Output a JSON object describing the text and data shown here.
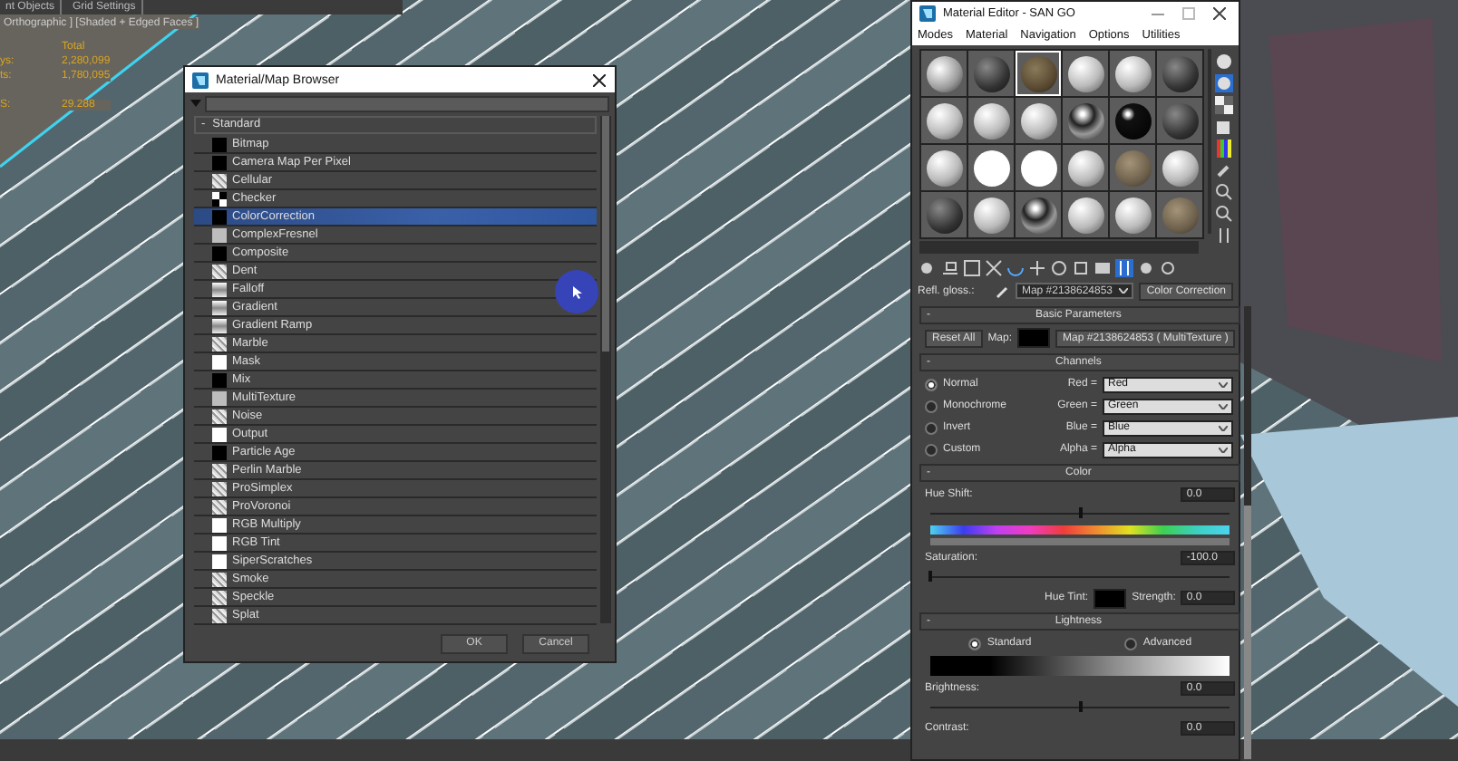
{
  "viewport": {
    "tabs": [
      "nt Objects",
      "Grid Settings"
    ],
    "label": "Orthographic ] [Shaded + Edged Faces ]",
    "stats": {
      "heading": "Total",
      "rows": [
        {
          "kind": "count",
          "label": "ys:",
          "value": "2,280,099"
        },
        {
          "kind": "count",
          "label": "ts:",
          "value": "1,780,095"
        },
        {
          "kind": "fps",
          "label": "S:",
          "value": "29.288"
        }
      ]
    }
  },
  "map_browser": {
    "title": "Material/Map Browser",
    "group": {
      "toggle": "-",
      "label": "Standard"
    },
    "items": [
      {
        "label": "Bitmap",
        "kind": "black",
        "selected": false
      },
      {
        "label": "Camera Map Per Pixel",
        "kind": "black",
        "selected": false
      },
      {
        "label": "Cellular",
        "kind": "noise",
        "selected": false
      },
      {
        "label": "Checker",
        "kind": "checker",
        "selected": false
      },
      {
        "label": "ColorCorrection",
        "kind": "black",
        "selected": true
      },
      {
        "label": "ComplexFresnel",
        "kind": "grey",
        "selected": false
      },
      {
        "label": "Composite",
        "kind": "black",
        "selected": false
      },
      {
        "label": "Dent",
        "kind": "noise",
        "selected": false
      },
      {
        "label": "Falloff",
        "kind": "gradient",
        "selected": false
      },
      {
        "label": "Gradient",
        "kind": "gradient",
        "selected": false
      },
      {
        "label": "Gradient Ramp",
        "kind": "gradient",
        "selected": false
      },
      {
        "label": "Marble",
        "kind": "noise",
        "selected": false
      },
      {
        "label": "Mask",
        "kind": "white",
        "selected": false
      },
      {
        "label": "Mix",
        "kind": "black",
        "selected": false
      },
      {
        "label": "MultiTexture",
        "kind": "grey",
        "selected": false
      },
      {
        "label": "Noise",
        "kind": "noise",
        "selected": false
      },
      {
        "label": "Output",
        "kind": "white",
        "selected": false
      },
      {
        "label": "Particle Age",
        "kind": "black",
        "selected": false
      },
      {
        "label": "Perlin Marble",
        "kind": "noise",
        "selected": false
      },
      {
        "label": "ProSimplex",
        "kind": "noise",
        "selected": false
      },
      {
        "label": "ProVoronoi",
        "kind": "noise",
        "selected": false
      },
      {
        "label": "RGB Multiply",
        "kind": "white",
        "selected": false
      },
      {
        "label": "RGB Tint",
        "kind": "white",
        "selected": false
      },
      {
        "label": "SiperScratches",
        "kind": "white",
        "selected": false
      },
      {
        "label": "Smoke",
        "kind": "noise",
        "selected": false
      },
      {
        "label": "Speckle",
        "kind": "noise",
        "selected": false
      },
      {
        "label": "Splat",
        "kind": "noise",
        "selected": false
      }
    ],
    "buttons": [
      "OK",
      "Cancel"
    ]
  },
  "material_editor": {
    "title": "Material Editor - SAN GO",
    "menu": [
      "Modes",
      "Material",
      "Navigation",
      "Options",
      "Utilities"
    ],
    "slots": [
      {
        "kind": "pattern",
        "selected": false
      },
      {
        "kind": "dark",
        "selected": false
      },
      {
        "kind": "wood",
        "selected": true
      },
      {
        "kind": "light",
        "selected": false
      },
      {
        "kind": "light",
        "selected": false
      },
      {
        "kind": "dark",
        "selected": false
      },
      {
        "kind": "light",
        "selected": false
      },
      {
        "kind": "light",
        "selected": false
      },
      {
        "kind": "light",
        "selected": false
      },
      {
        "kind": "chrome",
        "selected": false
      },
      {
        "kind": "black",
        "selected": false
      },
      {
        "kind": "dark",
        "selected": false
      },
      {
        "kind": "light",
        "selected": false
      },
      {
        "kind": "flat",
        "selected": false
      },
      {
        "kind": "flat",
        "selected": false
      },
      {
        "kind": "light",
        "selected": false
      },
      {
        "kind": "stone",
        "selected": false
      },
      {
        "kind": "light",
        "selected": false
      },
      {
        "kind": "dark",
        "selected": false
      },
      {
        "kind": "light",
        "selected": false
      },
      {
        "kind": "chrome",
        "selected": false
      },
      {
        "kind": "light",
        "selected": false
      },
      {
        "kind": "light",
        "selected": false
      },
      {
        "kind": "stone",
        "selected": false
      }
    ],
    "map_row": {
      "label": "Refl. gloss.:",
      "map": "Map #2138624853",
      "type_button": "Color Correction"
    },
    "basic_parameters": {
      "toggle": "-",
      "title": "Basic Parameters",
      "reset": "Reset All",
      "map_label": "Map:",
      "map_button": "Map #2138624853 ( MultiTexture )"
    },
    "channels": {
      "toggle": "-",
      "title": "Channels",
      "modes": [
        {
          "label": "Normal",
          "selected": true
        },
        {
          "label": "Monochrome",
          "selected": false
        },
        {
          "label": "Invert",
          "selected": false
        },
        {
          "label": "Custom",
          "selected": false
        }
      ],
      "mappings": [
        {
          "label": "Red =",
          "value": "Red"
        },
        {
          "label": "Green =",
          "value": "Green"
        },
        {
          "label": "Blue =",
          "value": "Blue"
        },
        {
          "label": "Alpha =",
          "value": "Alpha"
        }
      ]
    },
    "color": {
      "toggle": "-",
      "title": "Color",
      "hue_shift": {
        "label": "Hue Shift:",
        "value": "0.0",
        "level": 0.5
      },
      "saturation": {
        "label": "Saturation:",
        "value": "-100.0",
        "level": 0.0
      },
      "hue_tint": {
        "label": "Hue Tint:"
      },
      "strength": {
        "label": "Strength:",
        "value": "0.0"
      }
    },
    "lightness": {
      "toggle": "-",
      "title": "Lightness",
      "modes": [
        {
          "label": "Standard",
          "selected": true
        },
        {
          "label": "Advanced",
          "selected": false
        }
      ],
      "brightness": {
        "label": "Brightness:",
        "value": "0.0",
        "level": 0.5
      },
      "contrast": {
        "label": "Contrast:",
        "value": "0.0"
      }
    }
  }
}
